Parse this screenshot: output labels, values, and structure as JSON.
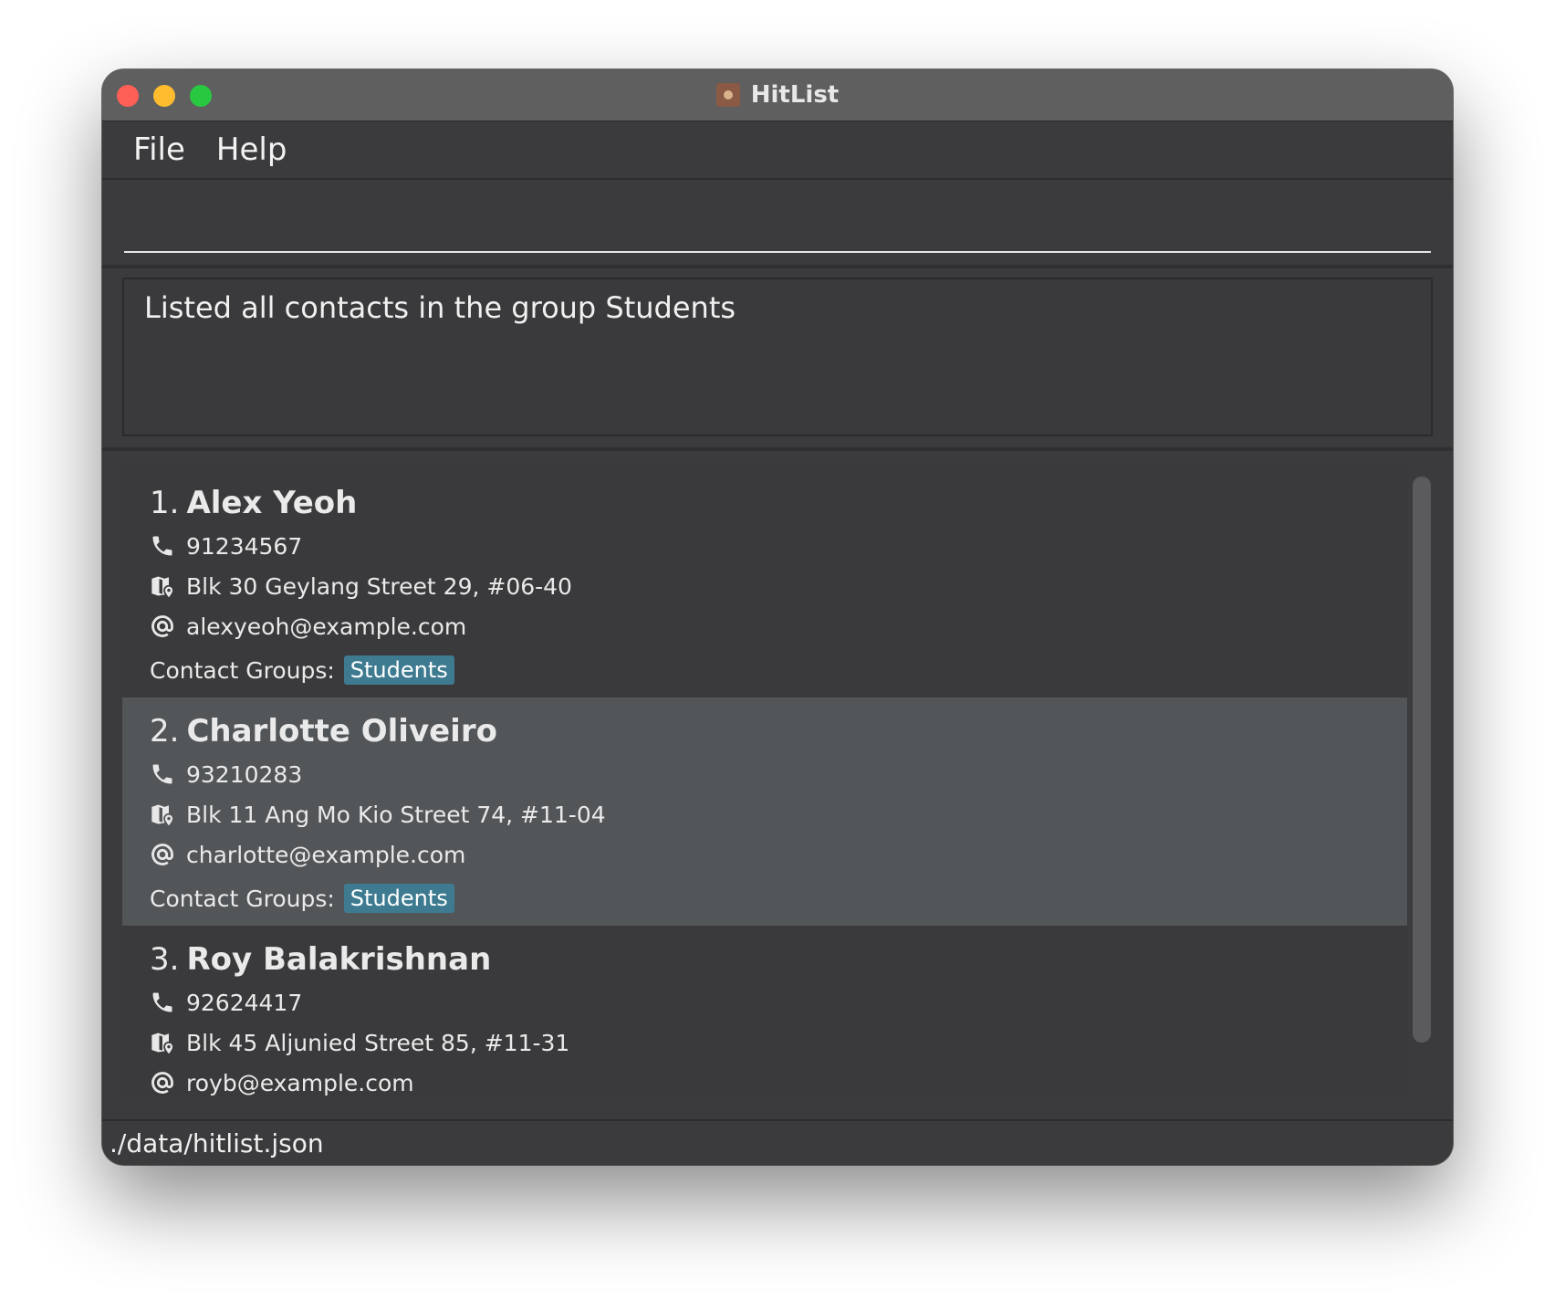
{
  "window": {
    "title": "HitList"
  },
  "menu": {
    "file": "File",
    "help": "Help"
  },
  "command": {
    "value": "",
    "placeholder": ""
  },
  "result": {
    "message": "Listed all contacts in the group Students"
  },
  "contacts": [
    {
      "index": "1.",
      "name": "Alex Yeoh",
      "phone": "91234567",
      "address": "Blk 30 Geylang Street 29, #06-40",
      "email": "alexyeoh@example.com",
      "groups_label": "Contact Groups:",
      "groups": [
        "Students"
      ]
    },
    {
      "index": "2.",
      "name": "Charlotte Oliveiro",
      "phone": "93210283",
      "address": "Blk 11 Ang Mo Kio Street 74, #11-04",
      "email": "charlotte@example.com",
      "groups_label": "Contact Groups:",
      "groups": [
        "Students"
      ]
    },
    {
      "index": "3.",
      "name": "Roy Balakrishnan",
      "phone": "92624417",
      "address": "Blk 45 Aljunied Street 85, #11-31",
      "email": "royb@example.com"
    }
  ],
  "status": {
    "file_path": "./data/hitlist.json"
  },
  "icons": {
    "phone": "phone-icon",
    "address": "map-icon",
    "email": "at-icon"
  },
  "colors": {
    "window_bg": "#3b3b3d",
    "titlebar": "#5f5f5f",
    "selected_card": "#525659",
    "tag_bg": "#3e7b91"
  }
}
